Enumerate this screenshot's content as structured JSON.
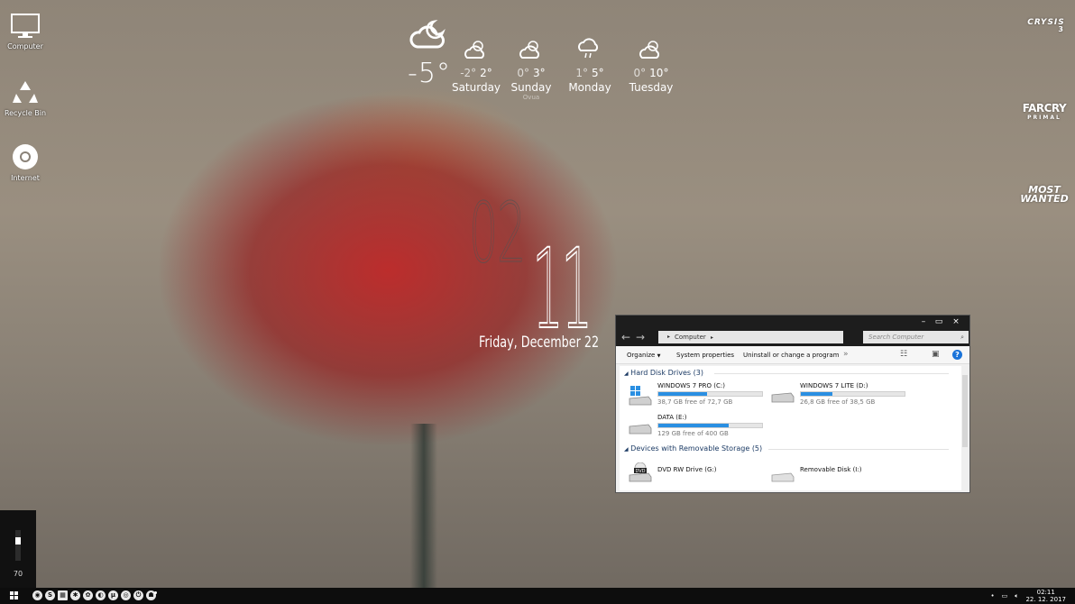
{
  "desktop_icons": [
    {
      "label": "Computer",
      "icon": "monitor-icon"
    },
    {
      "label": "Recycle Bin",
      "icon": "recycle-bin-icon"
    },
    {
      "label": "Internet",
      "icon": "chrome-icon"
    }
  ],
  "weather": {
    "current_temp": "-5°",
    "current_icon": "cloud-moon-icon",
    "days": [
      {
        "name": "Saturday",
        "low": "-2°",
        "high": "2°",
        "icon": "partly-cloudy-icon",
        "sub": ""
      },
      {
        "name": "Sunday",
        "low": "0°",
        "high": "3°",
        "icon": "partly-cloudy-icon",
        "sub": "Ovua"
      },
      {
        "name": "Monday",
        "low": "1°",
        "high": "5°",
        "icon": "rain-icon",
        "sub": ""
      },
      {
        "name": "Tuesday",
        "low": "0°",
        "high": "10°",
        "icon": "partly-cloudy-icon",
        "sub": ""
      }
    ]
  },
  "clock": {
    "hours": "02",
    "minutes": "11",
    "date": "Friday, December 22"
  },
  "game_logos": [
    {
      "line1": "CRYSIS",
      "line2": "3"
    },
    {
      "line1": "FARCRY",
      "line2": "PRIMAL"
    },
    {
      "line1": "MOST",
      "line2": "WANTED"
    }
  ],
  "volume": {
    "value": "70",
    "level": 0.7
  },
  "explorer": {
    "address": "Computer",
    "search_placeholder": "Search Computer",
    "toolbar": {
      "organize": "Organize",
      "system_properties": "System properties",
      "uninstall": "Uninstall or change a program",
      "more": "»"
    },
    "groups": {
      "hdd": "Hard Disk Drives (3)",
      "removable": "Devices with Removable Storage (5)"
    },
    "drives": [
      {
        "name": "WINDOWS 7 PRO (C:)",
        "free": "38,7 GB free of 72,7 GB",
        "used_fraction": 0.47
      },
      {
        "name": "WINDOWS 7 LITE (D:)",
        "free": "26,8 GB free of 38,5 GB",
        "used_fraction": 0.3
      },
      {
        "name": "DATA (E:)",
        "free": "129 GB free of 400 GB",
        "used_fraction": 0.68
      }
    ],
    "removable": [
      {
        "name": "DVD RW Drive (G:)",
        "icon": "dvd-drive-icon"
      },
      {
        "name": "Removable Disk (I:)",
        "icon": "removable-disk-icon"
      }
    ]
  },
  "taskbar": {
    "time": "02:11",
    "date": "22. 12. 2017"
  }
}
